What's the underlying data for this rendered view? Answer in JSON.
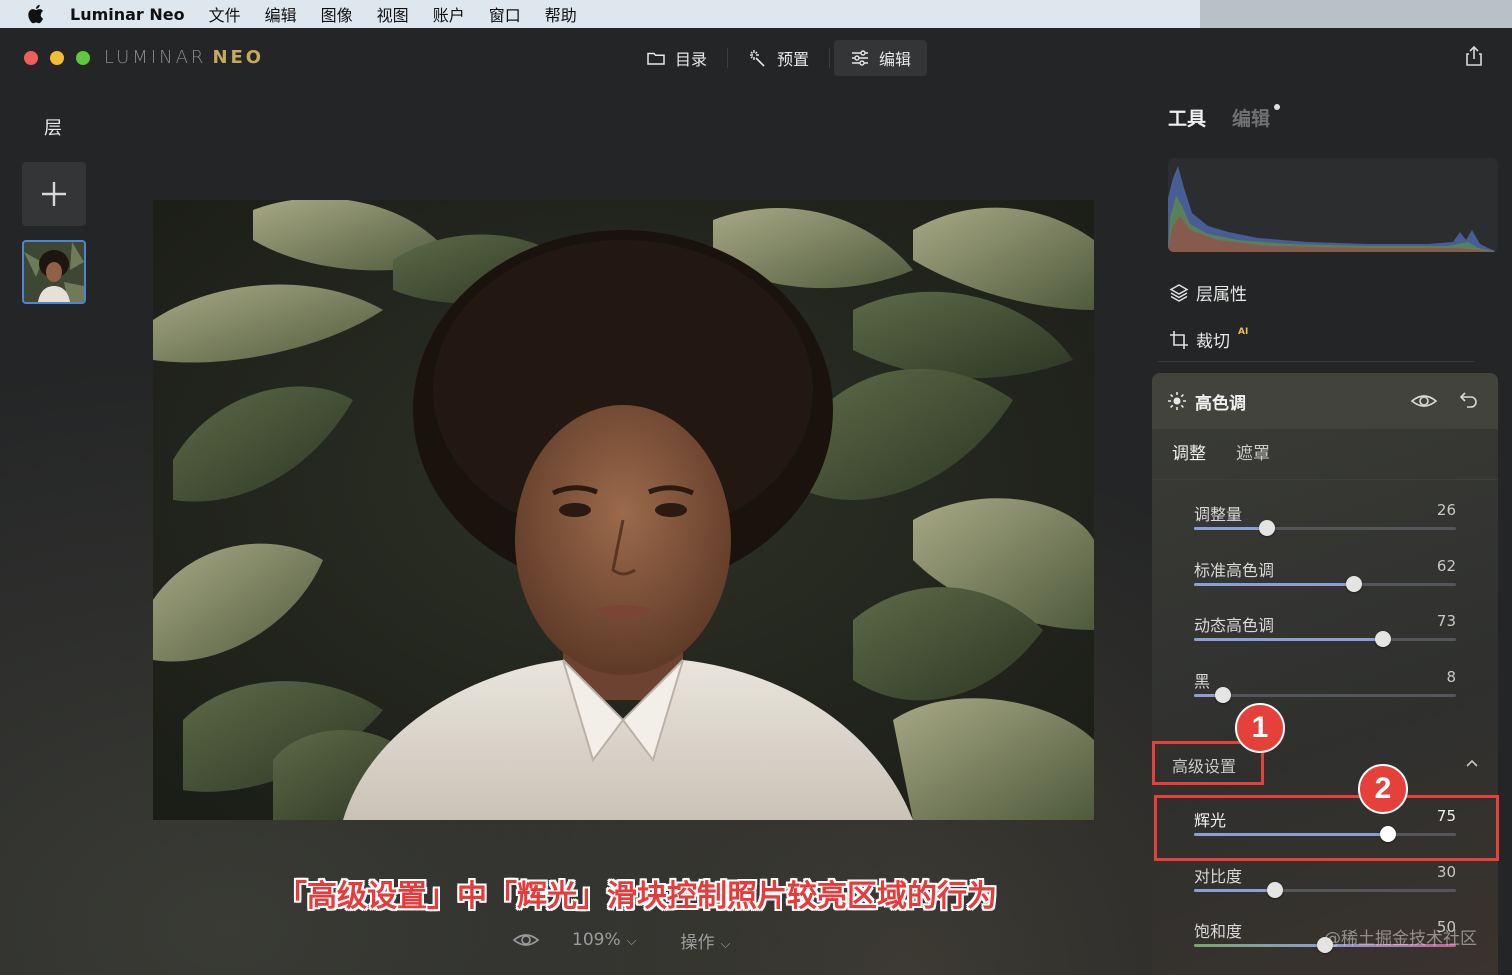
{
  "menubar": {
    "app_name": "Luminar Neo",
    "items": [
      "文件",
      "编辑",
      "图像",
      "视图",
      "账户",
      "窗口",
      "帮助"
    ]
  },
  "window": {
    "brand_left": "LUMINAR",
    "brand_right": "NEO"
  },
  "top_tabs": [
    {
      "label": "目录",
      "icon": "folder-icon",
      "active": false
    },
    {
      "label": "预置",
      "icon": "magic-wand-icon",
      "active": false
    },
    {
      "label": "编辑",
      "icon": "sliders-icon",
      "active": true
    }
  ],
  "layers": {
    "title": "层"
  },
  "bottom_bar": {
    "zoom": "109%",
    "actions": "操作"
  },
  "caption": "「高级设置」中「辉光」滑块控制照片较亮区域的行为",
  "right_panel": {
    "tabs": {
      "tools": "工具",
      "edits": "编辑"
    },
    "items": {
      "layer_properties": "层属性",
      "crop": "裁切",
      "crop_badge": "AI"
    },
    "tool": {
      "name": "高色调",
      "subtabs": {
        "adjust": "调整",
        "mask": "遮罩"
      },
      "sliders": [
        {
          "label": "调整量",
          "value": "26",
          "level": 0.28
        },
        {
          "label": "标准高色调",
          "value": "62",
          "level": 0.61
        },
        {
          "label": "动态高色调",
          "value": "73",
          "level": 0.72
        },
        {
          "label": "黑",
          "value": "8",
          "level": 0.11
        }
      ],
      "advanced_label": "高级设置",
      "advanced_sliders": [
        {
          "label": "辉光",
          "value": "75",
          "level": 0.74
        },
        {
          "label": "对比度",
          "value": "30",
          "level": 0.31
        },
        {
          "label": "饱和度",
          "value": "50",
          "level": 0.5
        }
      ]
    }
  },
  "annotations": {
    "step1": "1",
    "step2": "2"
  },
  "watermark": "@稀土掘金技术社区",
  "colors": {
    "accent_blue": "#4b86d6",
    "slider_fill": "#8a9fd6",
    "annotation_red": "#e5413a",
    "caption_red": "#e93a3a"
  }
}
